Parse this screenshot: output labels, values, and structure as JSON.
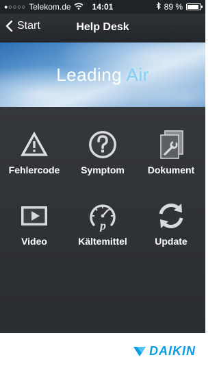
{
  "statusbar": {
    "carrier": "Telekom.de",
    "time": "14:01",
    "battery_text": "89 %",
    "battery_level": 0.89
  },
  "navbar": {
    "back_label": "Start",
    "title": "Help Desk"
  },
  "banner": {
    "word1": "Leading",
    "word2": "Air"
  },
  "menu": {
    "items": [
      {
        "label": "Fehlercode",
        "icon": "warning-triangle-icon"
      },
      {
        "label": "Symptom",
        "icon": "question-circle-icon"
      },
      {
        "label": "Dokument",
        "icon": "document-wrench-icon"
      },
      {
        "label": "Video",
        "icon": "play-video-icon"
      },
      {
        "label": "Kältemittel",
        "icon": "refrigerant-gauge-icon"
      },
      {
        "label": "Update",
        "icon": "refresh-icon"
      }
    ]
  },
  "footer": {
    "logo_text": "DAIKIN",
    "logo_color": "#0a9de0"
  }
}
